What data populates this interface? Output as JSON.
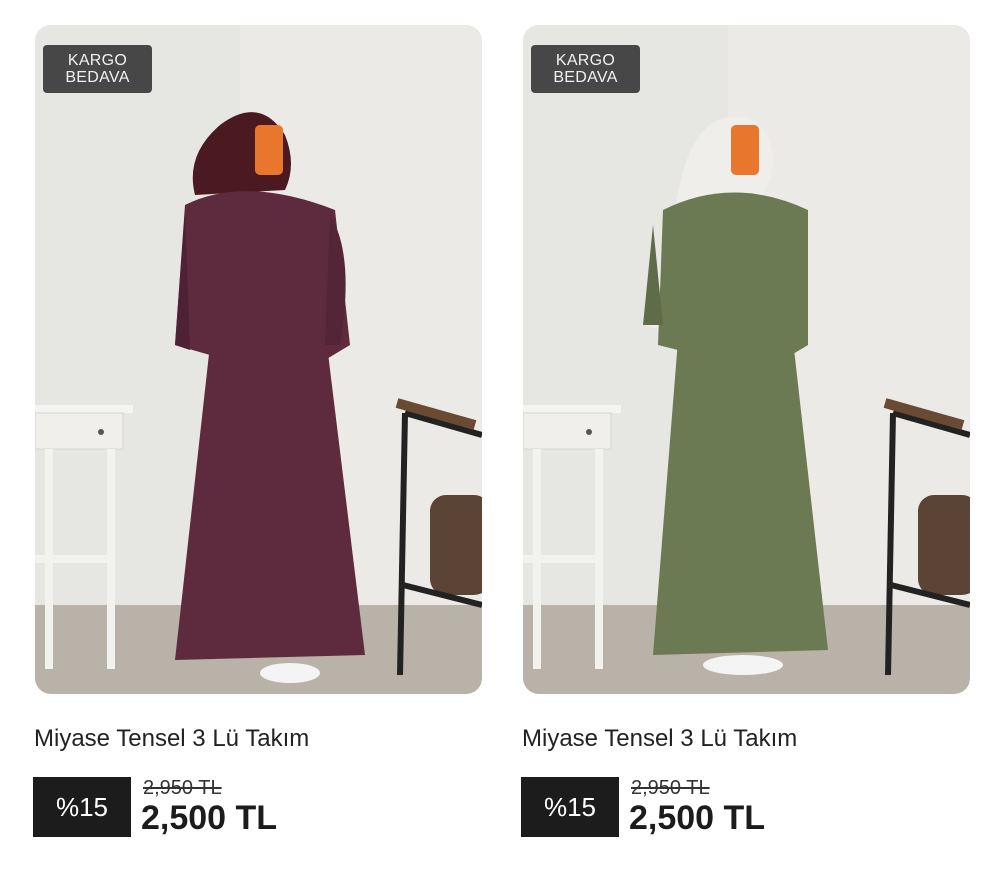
{
  "products": [
    {
      "badge_line1": "KARGO",
      "badge_line2": "BEDAVA",
      "title": "Miyase Tensel 3 Lü Takım",
      "discount": "%15",
      "old_price": "2,950 TL",
      "new_price": "2,500 TL",
      "color": "#5e2a3e"
    },
    {
      "badge_line1": "KARGO",
      "badge_line2": "BEDAVA",
      "title": "Miyase Tensel 3 Lü Takım",
      "discount": "%15",
      "old_price": "2,950 TL",
      "new_price": "2,500 TL",
      "color": "#6c7a54"
    }
  ]
}
